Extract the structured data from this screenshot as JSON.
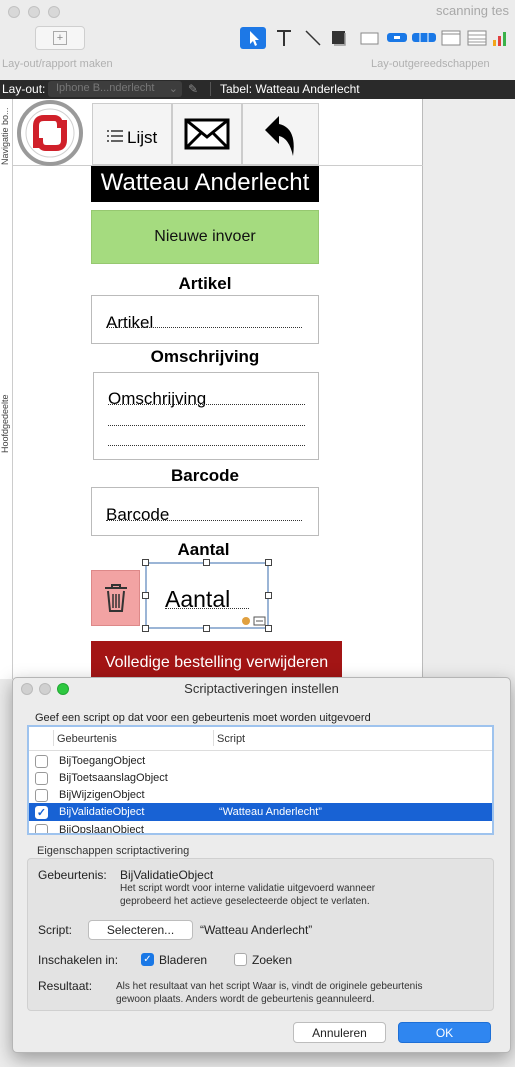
{
  "window": {
    "title": "scanning tes"
  },
  "toolbar": {
    "left_label": "Lay-out/rapport maken",
    "right_label": "Lay-outgereedschappen",
    "tools": [
      "pointer-icon",
      "text-icon",
      "line-icon",
      "rectangle-icon",
      "field-icon",
      "button-icon",
      "button-bar-icon",
      "tab-control-icon",
      "portal-icon",
      "chart-icon"
    ]
  },
  "layoutbar": {
    "label": "Lay-out:",
    "layout_value": "Iphone B...nderlecht",
    "table_label": "Tabel: Watteau Anderlecht"
  },
  "side_tabs": {
    "top": "Navigatie bo...",
    "middle": "Hoofdgedeelte"
  },
  "form": {
    "nav_list": "Lijst",
    "title": "Watteau Anderlecht",
    "new_entry": "Nieuwe invoer",
    "artikel_label": "Artikel",
    "artikel_field": "Artikel",
    "omschrijving_label": "Omschrijving",
    "omschrijving_field": "Omschrijving",
    "barcode_label": "Barcode",
    "barcode_field": "Barcode",
    "aantal_label": "Aantal",
    "aantal_field": "Aantal",
    "delete_order": "Volledige bestelling verwijderen"
  },
  "dialog": {
    "title": "Scriptactiveringen instellen",
    "prompt": "Geef een script op dat voor een gebeurtenis moet worden uitgevoerd",
    "columns": {
      "event": "Gebeurtenis",
      "script": "Script"
    },
    "rows": [
      {
        "name": "BijToegangObject",
        "script": "",
        "checked": false,
        "selected": false
      },
      {
        "name": "BijToetsaanslagObject",
        "script": "",
        "checked": false,
        "selected": false
      },
      {
        "name": "BijWijzigenObject",
        "script": "",
        "checked": false,
        "selected": false
      },
      {
        "name": "BijValidatieObject",
        "script": "“Watteau Anderlecht”",
        "checked": true,
        "selected": true
      },
      {
        "name": "BijOpslaanObject",
        "script": "",
        "checked": false,
        "selected": false
      }
    ],
    "props_title": "Eigenschappen scriptactivering",
    "event_label": "Gebeurtenis:",
    "event_value": "BijValidatieObject",
    "event_desc_1": "Het script wordt voor interne validatie uitgevoerd wanneer",
    "event_desc_2": "geprobeerd het actieve geselecteerde object te verlaten.",
    "script_label": "Script:",
    "select_button": "Selecteren...",
    "script_value": "“Watteau Anderlecht”",
    "enable_label": "Inschakelen in:",
    "browse_label": "Bladeren",
    "browse_checked": true,
    "find_label": "Zoeken",
    "find_checked": false,
    "result_label": "Resultaat:",
    "result_text_1": "Als het resultaat van het script Waar is, vindt de originele gebeurtenis",
    "result_text_2": "gewoon plaats. Anders wordt de gebeurtenis geannuleerd.",
    "cancel": "Annuleren",
    "ok": "OK"
  },
  "colors": {
    "accent": "#1a78e6",
    "new_entry_bg": "#a5db7f",
    "delete_bg": "#a31515",
    "trash_bg": "#f2a3a3",
    "title_bg": "#000000"
  }
}
